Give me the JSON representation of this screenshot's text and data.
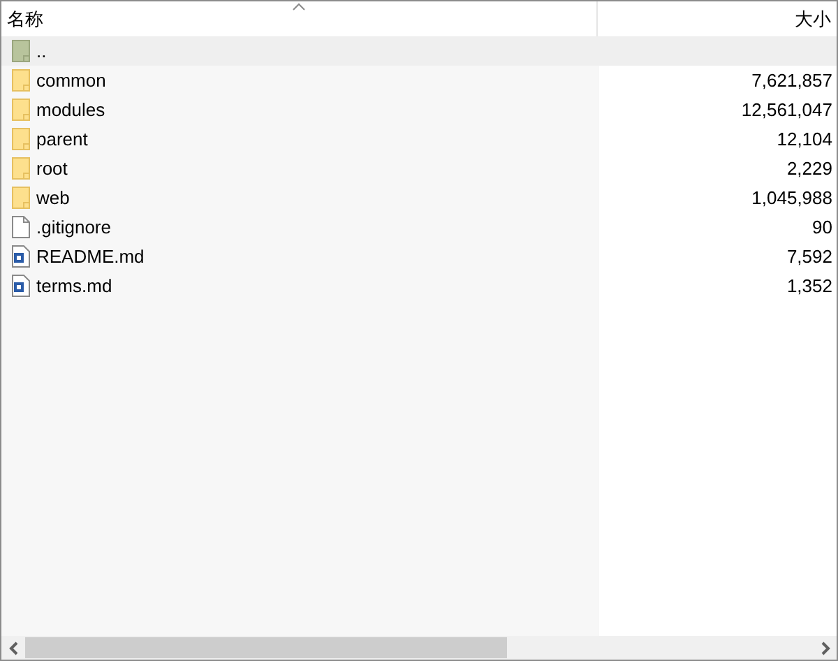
{
  "columns": [
    {
      "label": "名称",
      "sorted": true
    },
    {
      "label": "大小",
      "sorted": false
    }
  ],
  "rows": [
    {
      "kind": "parent",
      "name": "..",
      "size": "",
      "selected": true
    },
    {
      "kind": "folder",
      "name": "common",
      "size": "7,621,857",
      "selected": false
    },
    {
      "kind": "folder",
      "name": "modules",
      "size": "12,561,047",
      "selected": false
    },
    {
      "kind": "folder",
      "name": "parent",
      "size": "12,104",
      "selected": false
    },
    {
      "kind": "folder",
      "name": "root",
      "size": "2,229",
      "selected": false
    },
    {
      "kind": "folder",
      "name": "web",
      "size": "1,045,988",
      "selected": false
    },
    {
      "kind": "file",
      "name": ".gitignore",
      "size": "90",
      "selected": false
    },
    {
      "kind": "document",
      "name": "README.md",
      "size": "7,592",
      "selected": false
    },
    {
      "kind": "document",
      "name": "terms.md",
      "size": "1,352",
      "selected": false
    }
  ]
}
